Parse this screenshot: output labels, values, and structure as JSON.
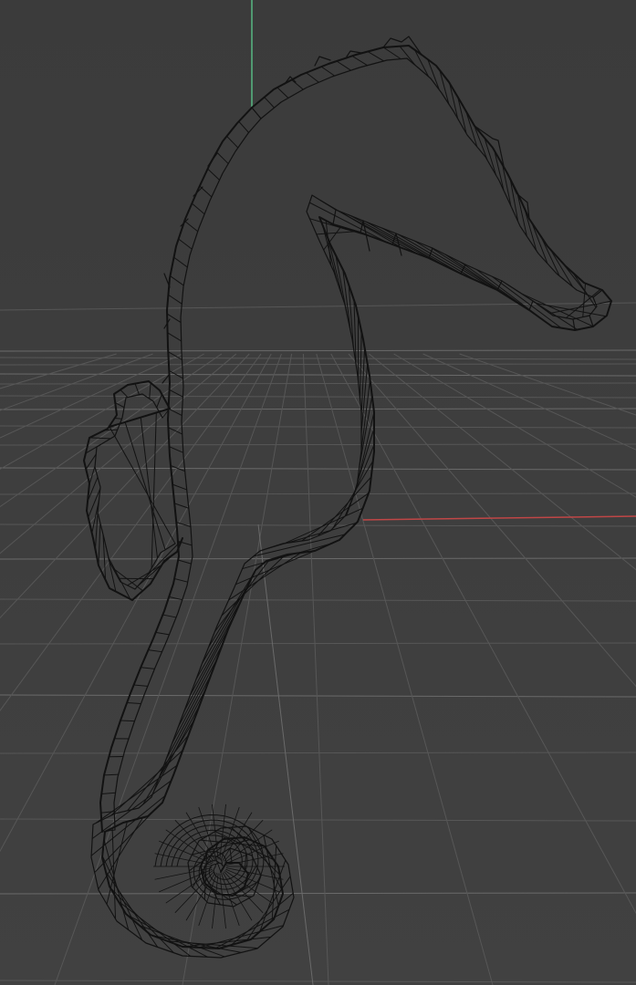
{
  "viewport": {
    "colors": {
      "background_top": "#3b3b3b",
      "background_bottom": "#414141",
      "grid": "#6a6a6a",
      "grid_faint": "#575757",
      "axis_x": "#c04646",
      "axis_y": "#57b883",
      "wire": "#121212"
    },
    "object_icon": "seahorse-wireframe-icon"
  }
}
